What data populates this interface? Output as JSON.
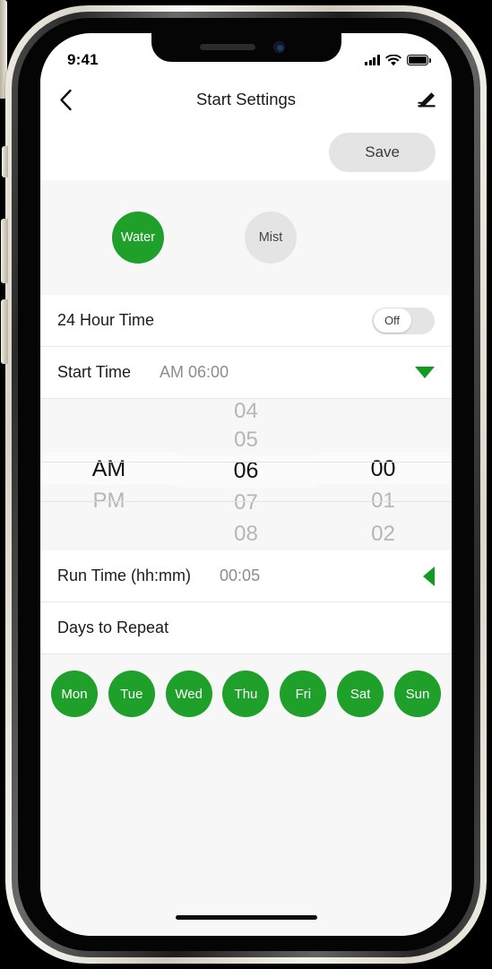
{
  "status_bar": {
    "time": "9:41",
    "cellular_icon": "cellular-bars-icon",
    "wifi_icon": "wifi-icon",
    "battery_icon": "battery-full-icon"
  },
  "nav": {
    "back_icon": "chevron-left-icon",
    "title": "Start Settings",
    "edit_icon": "pencil-edit-icon"
  },
  "toolbar": {
    "save_label": "Save"
  },
  "mode_selector": {
    "options": [
      {
        "label": "Water",
        "selected": true
      },
      {
        "label": "Mist",
        "selected": false
      }
    ]
  },
  "rows": {
    "hour_format": {
      "label": "24 Hour Time",
      "toggle_state": "Off",
      "toggle_on": false
    },
    "start_time": {
      "label": "Start Time",
      "value": "AM 06:00",
      "caret": "caret-down-icon",
      "expanded": true
    },
    "run_time": {
      "label": "Run Time (hh:mm)",
      "value": "00:05",
      "caret": "caret-left-icon",
      "expanded": false
    },
    "days_to_repeat": {
      "label": "Days to Repeat"
    }
  },
  "time_picker": {
    "meridiem": {
      "above": "",
      "selected": "AM",
      "below": "PM",
      "below2": ""
    },
    "hours": {
      "above2": "04",
      "above": "05",
      "selected": "06",
      "below": "07",
      "below2": "08"
    },
    "minutes": {
      "above2": "",
      "above": "",
      "selected": "00",
      "below": "01",
      "below2": "02"
    }
  },
  "days": [
    {
      "label": "Mon",
      "selected": true
    },
    {
      "label": "Tue",
      "selected": true
    },
    {
      "label": "Wed",
      "selected": true
    },
    {
      "label": "Thu",
      "selected": true
    },
    {
      "label": "Fri",
      "selected": true
    },
    {
      "label": "Sat",
      "selected": true
    },
    {
      "label": "Sun",
      "selected": true
    }
  ],
  "colors": {
    "accent_green": "#1ea02a",
    "caret_green": "#109c21",
    "chip_gray": "#e4e4e4",
    "section_bg": "#f7f7f7"
  }
}
